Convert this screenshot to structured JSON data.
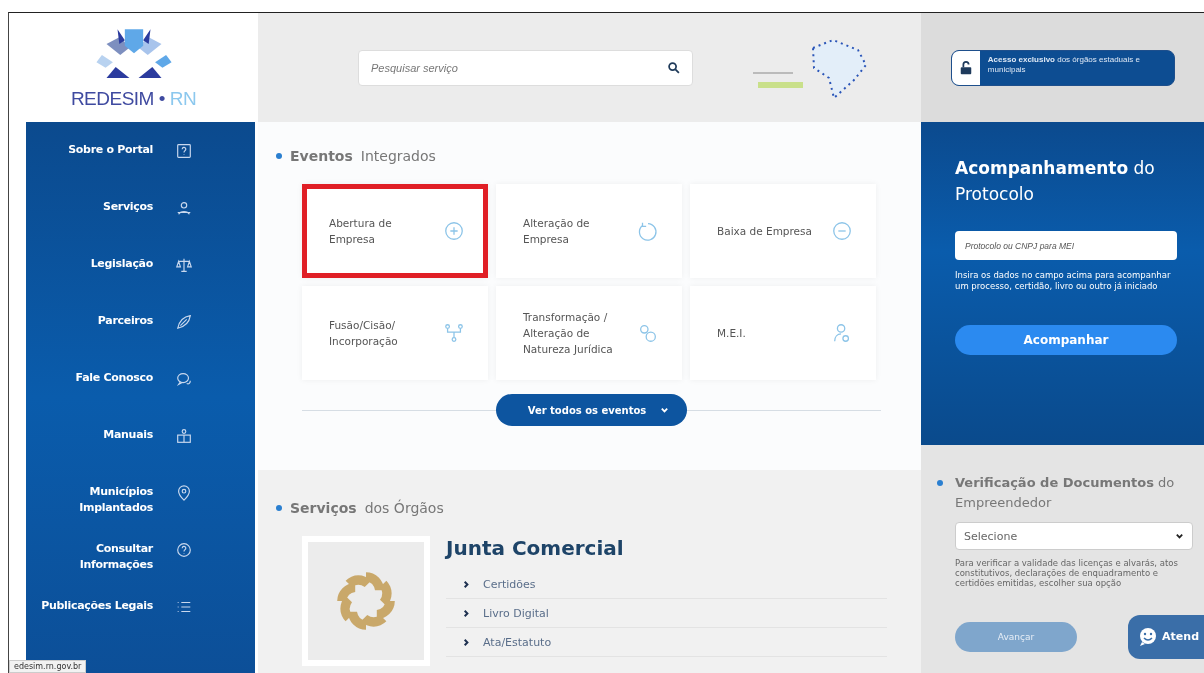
{
  "brand": {
    "name": "REDESIM",
    "separator": "•",
    "suffix": "RN"
  },
  "search": {
    "placeholder": "Pesquisar serviço"
  },
  "access_button": {
    "label": "**Acesso exclusivo** dos órgãos estaduais e municipais"
  },
  "sidebar": {
    "items": [
      {
        "label": "Sobre o Portal",
        "kind": "question"
      },
      {
        "label": "Serviços",
        "kind": "person"
      },
      {
        "label": "Legislação",
        "kind": "scales"
      },
      {
        "label": "Parceiros",
        "kind": "leaf"
      },
      {
        "label": "Fale Conosco",
        "kind": "chat"
      },
      {
        "label": "Manuais",
        "kind": "book"
      },
      {
        "label": "Municípios Implantados",
        "kind": "pin"
      },
      {
        "label": "Consultar Informações",
        "kind": "help"
      },
      {
        "label": "Publicações Legais",
        "kind": "list"
      }
    ]
  },
  "events": {
    "title": "**Eventos** Integrados",
    "cards": [
      {
        "label": "Abertura de Empresa",
        "kind": "plus",
        "highlighted": true
      },
      {
        "label": "Alteração de Empresa",
        "kind": "cycle",
        "highlighted": false
      },
      {
        "label": "Baixa de Empresa",
        "kind": "minus",
        "highlighted": false
      },
      {
        "label": "Fusão/Cisão/ Incorporação",
        "kind": "merge",
        "highlighted": false
      },
      {
        "label": "Transformação / Alteração de Natureza Jurídica",
        "kind": "circles",
        "highlighted": false
      },
      {
        "label": "M.E.I.",
        "kind": "user",
        "highlighted": false
      }
    ],
    "more_button": "Ver todos os eventos"
  },
  "services": {
    "title": "**Serviços** dos Órgãos",
    "organ": "Junta Comercial",
    "links": [
      "Certidões",
      "Livro Digital",
      "Ata/Estatuto"
    ]
  },
  "protocol": {
    "title": "**Acompanhamento** do Protocolo",
    "placeholder": "Protocolo ou CNPJ para MEI",
    "help": "Insira os dados no campo acima para acompanhar um processo, certidão, livro ou outro já iniciado",
    "button": "Acompanhar"
  },
  "verification": {
    "title": "**Verificação de Documentos** do Empreendedor",
    "select": "Selecione",
    "help": "Para verificar a validade das licenças e alvarás, atos constitutivos, declarações de enquadramento e certidões emitidas, escolher sua opção",
    "button": {
      "label": "Avançar",
      "disabled": true
    }
  },
  "chat_button": "Atend",
  "status_bar": "edesim.rn.gov.br"
}
